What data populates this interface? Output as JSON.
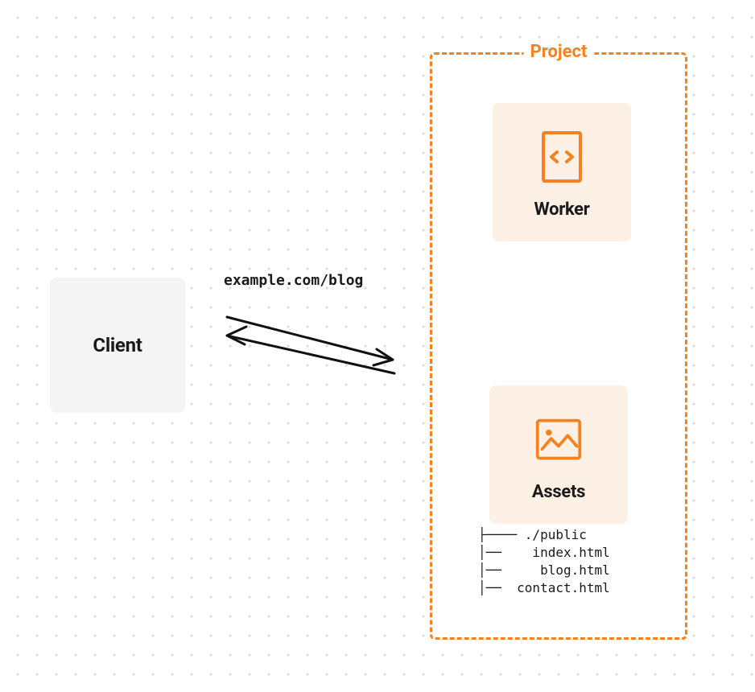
{
  "client": {
    "label": "Client"
  },
  "request": {
    "url": "example.com/blog"
  },
  "project": {
    "title": "Project",
    "worker": {
      "label": "Worker"
    },
    "assets": {
      "label": "Assets",
      "tree": {
        "root": "├──── ./public",
        "files": [
          "│──    index.html",
          "│──     blog.html",
          "│──  contact.html"
        ]
      }
    }
  }
}
